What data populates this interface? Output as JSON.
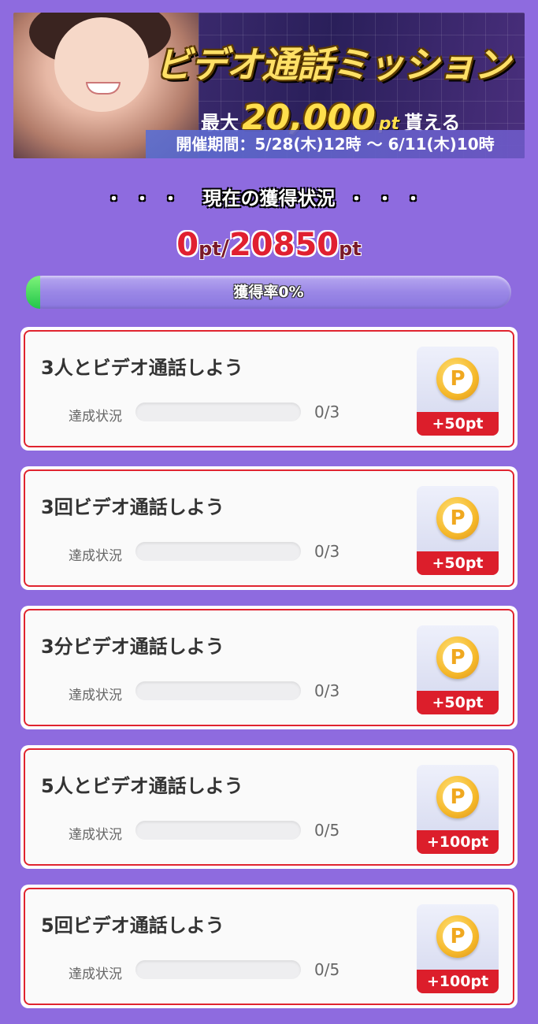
{
  "banner": {
    "headline": "ビデオ通話ミッション",
    "sub_prefix": "最大",
    "sub_amount": "20,000",
    "sub_unit": "pt",
    "sub_suffix": "貰える",
    "period": "開催期間：5/28(木)12時 〜 6/11(木)10時"
  },
  "status": {
    "title": "現在の獲得状況",
    "dots": "・・・",
    "current_points": "0",
    "unit": "pt",
    "separator": "/",
    "total_points": "20850",
    "rate_label": "獲得率0%",
    "rate_value": 0
  },
  "missions": [
    {
      "title": "3人とビデオ通話しよう",
      "progress_label": "達成状況",
      "progress_text": "0/3",
      "progress": 0,
      "reward": "+50pt",
      "coin_letter": "P"
    },
    {
      "title": "3回ビデオ通話しよう",
      "progress_label": "達成状況",
      "progress_text": "0/3",
      "progress": 0,
      "reward": "+50pt",
      "coin_letter": "P"
    },
    {
      "title": "3分ビデオ通話しよう",
      "progress_label": "達成状況",
      "progress_text": "0/3",
      "progress": 0,
      "reward": "+50pt",
      "coin_letter": "P"
    },
    {
      "title": "5人とビデオ通話しよう",
      "progress_label": "達成状況",
      "progress_text": "0/5",
      "progress": 0,
      "reward": "+100pt",
      "coin_letter": "P"
    },
    {
      "title": "5回ビデオ通話しよう",
      "progress_label": "達成状況",
      "progress_text": "0/5",
      "progress": 0,
      "reward": "+100pt",
      "coin_letter": "P"
    }
  ],
  "colors": {
    "background": "#8e6bdf",
    "accent_red": "#dc1e2b",
    "progress_green": "#21c64a",
    "coin_gold": "#f5b82a"
  },
  "icons": {
    "coin": "p-coin-icon"
  }
}
